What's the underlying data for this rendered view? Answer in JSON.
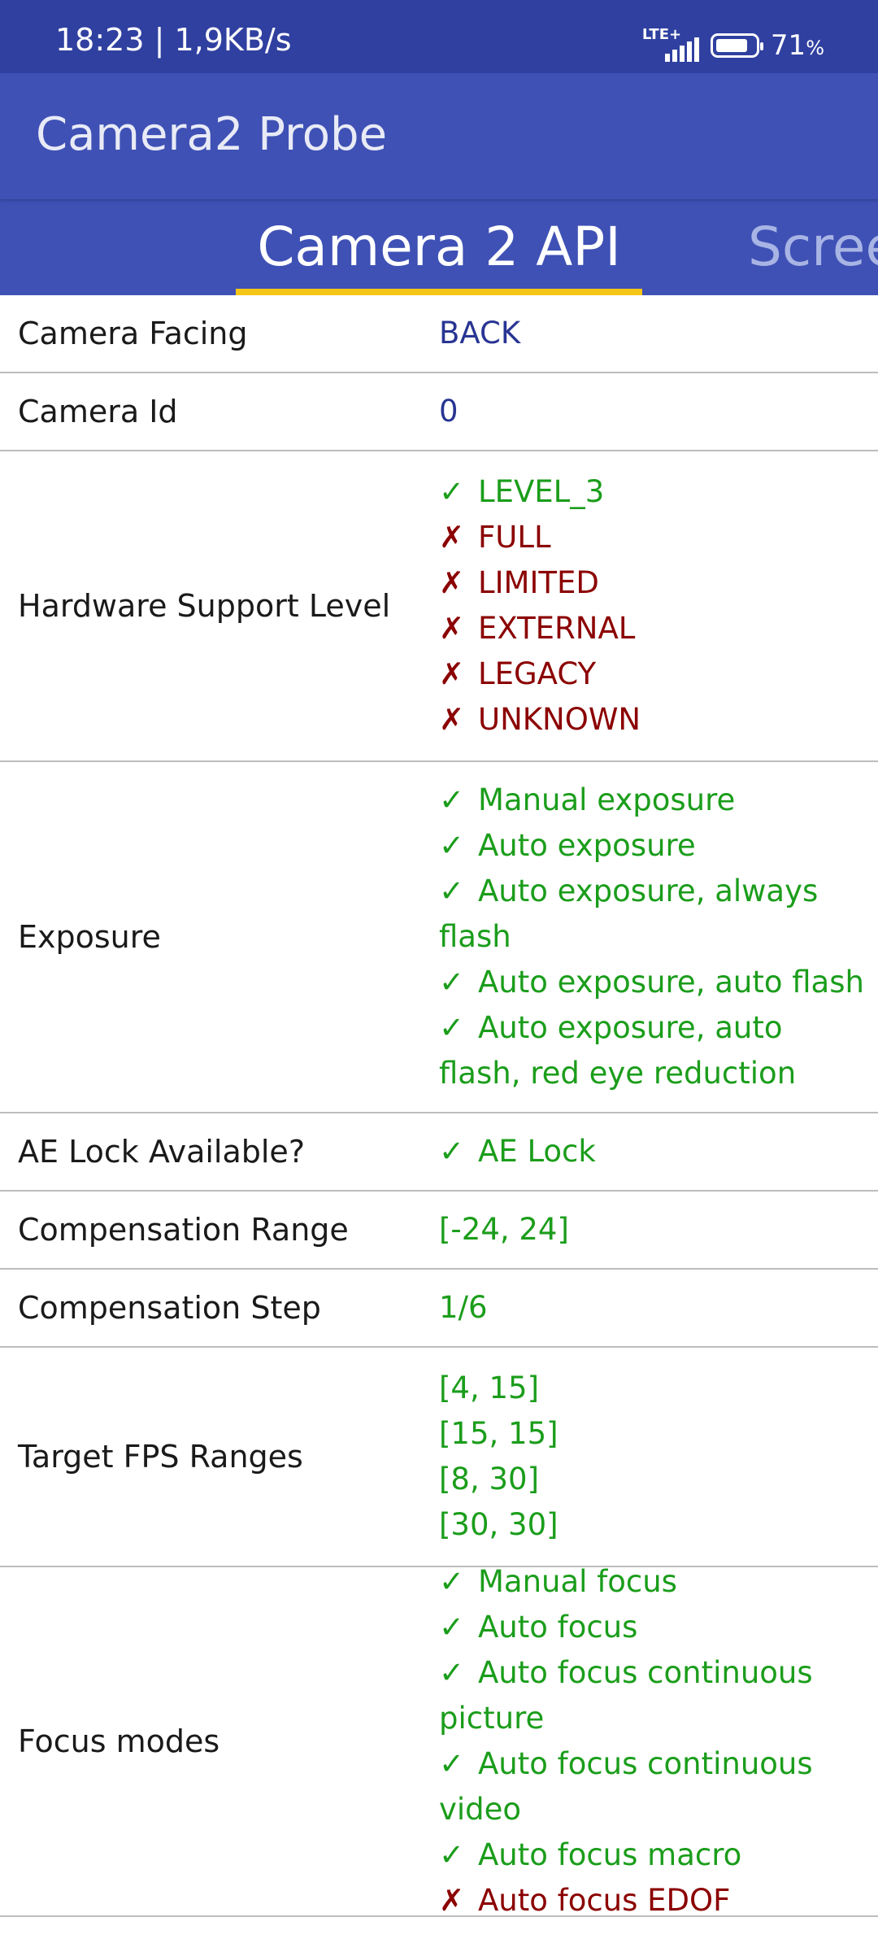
{
  "status_bar": {
    "time_speed": "18:23 | 1,9KB/s",
    "network": "LTE+",
    "battery_percent": "71",
    "battery_unit": "%"
  },
  "app": {
    "title": "Camera2 Probe"
  },
  "tabs": [
    {
      "label": "Camera 2 API",
      "active": true
    },
    {
      "label": "Scree",
      "active": false
    }
  ],
  "colors": {
    "status_bar": "#3040a0",
    "primary": "#3f51b5",
    "tab_indicator": "#f5c518",
    "supported": "#1b9d1b",
    "unsupported": "#8b0000",
    "info": "#283593"
  },
  "rows": [
    {
      "label": "Camera Facing",
      "values": [
        {
          "text": "BACK",
          "mark": "",
          "color": "blue"
        }
      ]
    },
    {
      "label": "Camera Id",
      "values": [
        {
          "text": "0",
          "mark": "",
          "color": "blue"
        }
      ]
    },
    {
      "label": "Hardware Support Level",
      "values": [
        {
          "text": "LEVEL_3",
          "mark": "✓",
          "color": "green"
        },
        {
          "text": "FULL",
          "mark": "✗",
          "color": "red"
        },
        {
          "text": "LIMITED",
          "mark": "✗",
          "color": "red"
        },
        {
          "text": "EXTERNAL",
          "mark": "✗",
          "color": "red"
        },
        {
          "text": "LEGACY",
          "mark": "✗",
          "color": "red"
        },
        {
          "text": "UNKNOWN",
          "mark": "✗",
          "color": "red"
        }
      ]
    },
    {
      "label": "Exposure",
      "values": [
        {
          "text": "Manual exposure",
          "mark": "✓",
          "color": "green"
        },
        {
          "text": "Auto exposure",
          "mark": "✓",
          "color": "green"
        },
        {
          "text": "Auto exposure, always flash",
          "mark": "✓",
          "color": "green"
        },
        {
          "text": "Auto exposure, auto flash",
          "mark": "✓",
          "color": "green"
        },
        {
          "text": "Auto exposure, auto flash, red eye reduction",
          "mark": "✓",
          "color": "green"
        }
      ]
    },
    {
      "label": "AE Lock Available?",
      "values": [
        {
          "text": "AE Lock",
          "mark": "✓",
          "color": "green"
        }
      ]
    },
    {
      "label": "Compensation Range",
      "values": [
        {
          "text": "[-24, 24]",
          "mark": "",
          "color": "green"
        }
      ]
    },
    {
      "label": "Compensation Step",
      "values": [
        {
          "text": "1/6",
          "mark": "",
          "color": "green"
        }
      ]
    },
    {
      "label": "Target FPS Ranges",
      "values": [
        {
          "text": "[4, 15]",
          "mark": "",
          "color": "green"
        },
        {
          "text": "[15, 15]",
          "mark": "",
          "color": "green"
        },
        {
          "text": "[8, 30]",
          "mark": "",
          "color": "green"
        },
        {
          "text": "[30, 30]",
          "mark": "",
          "color": "green"
        }
      ]
    },
    {
      "label": "Focus modes",
      "values": [
        {
          "text": "Manual focus",
          "mark": "✓",
          "color": "green"
        },
        {
          "text": "Auto focus",
          "mark": "✓",
          "color": "green"
        },
        {
          "text": "Auto focus continuous picture",
          "mark": "✓",
          "color": "green"
        },
        {
          "text": "Auto focus continuous video",
          "mark": "✓",
          "color": "green"
        },
        {
          "text": "Auto focus macro",
          "mark": "✓",
          "color": "green"
        },
        {
          "text": "Auto focus EDOF",
          "mark": "✗",
          "color": "red"
        }
      ]
    }
  ]
}
